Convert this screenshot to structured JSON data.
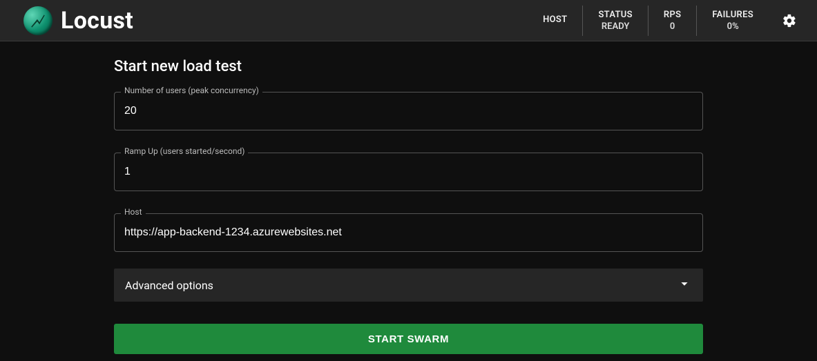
{
  "app": {
    "title": "Locust"
  },
  "header": {
    "stats": {
      "host": {
        "label": "HOST",
        "value": ""
      },
      "status": {
        "label": "STATUS",
        "value": "READY"
      },
      "rps": {
        "label": "RPS",
        "value": "0"
      },
      "failures": {
        "label": "FAILURES",
        "value": "0%"
      }
    }
  },
  "page": {
    "title": "Start new load test",
    "fields": {
      "users": {
        "label": "Number of users (peak concurrency)",
        "value": "20"
      },
      "ramp": {
        "label": "Ramp Up (users started/second)",
        "value": "1"
      },
      "host": {
        "label": "Host",
        "value": "https://app-backend-1234.azurewebsites.net"
      }
    },
    "advanced_label": "Advanced options",
    "start_label": "START SWARM"
  }
}
